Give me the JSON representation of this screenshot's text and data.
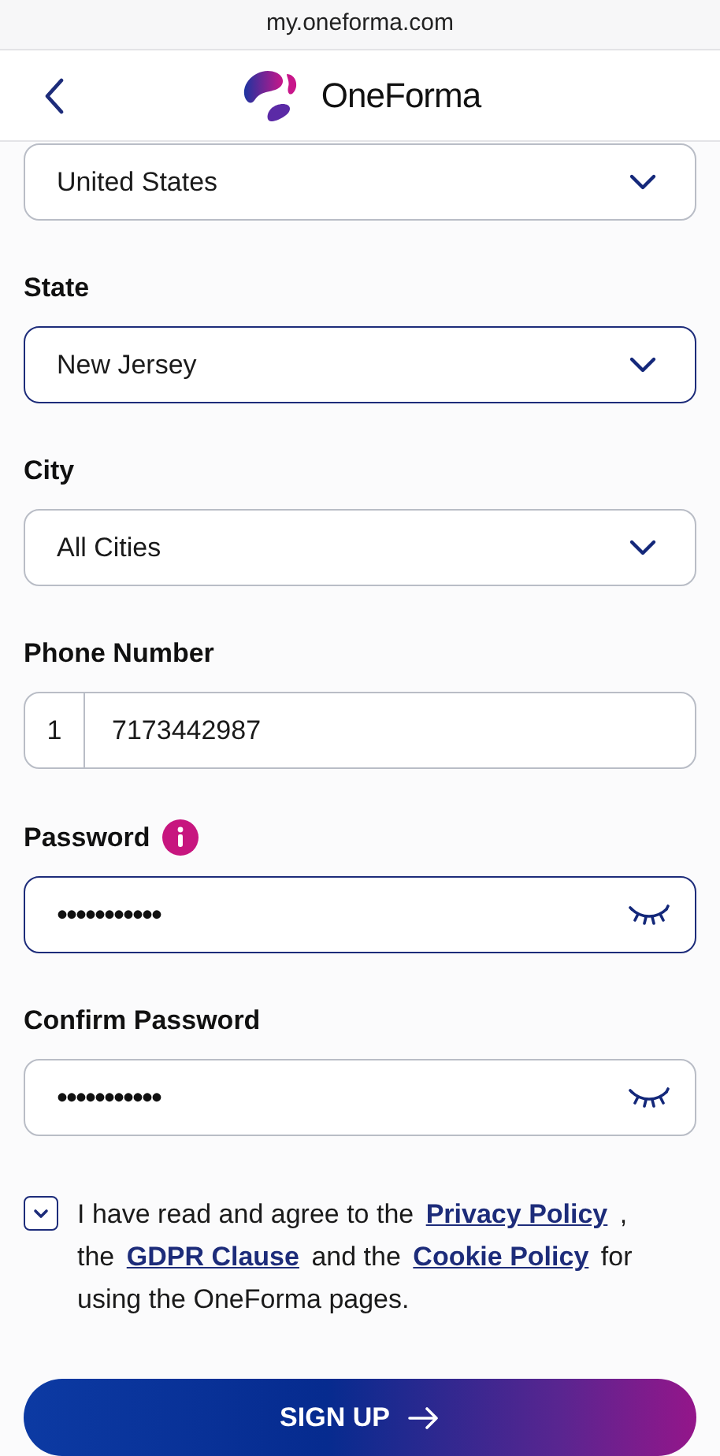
{
  "browser": {
    "url": "my.oneforma.com"
  },
  "header": {
    "brand": "OneForma"
  },
  "fields": [
    {
      "kind": "select",
      "value": "United States",
      "highlighted": false
    },
    {
      "kind": "select",
      "label": "State",
      "value": "New Jersey",
      "highlighted": true
    },
    {
      "kind": "select",
      "label": "City",
      "value": "All Cities",
      "highlighted": false
    },
    {
      "kind": "phone",
      "label": "Phone Number",
      "prefix": "1",
      "value": "7173442987",
      "highlighted": false
    },
    {
      "kind": "password",
      "label": "Password",
      "info": true,
      "value": "•••••••••••",
      "highlighted": true
    },
    {
      "kind": "password",
      "label": "Confirm Password",
      "info": false,
      "value": "•••••••••••",
      "highlighted": false
    }
  ],
  "agreement": {
    "checked": true,
    "parts": [
      {
        "kind": "text",
        "text": "I have read and agree to the"
      },
      {
        "kind": "link",
        "text": "Privacy Policy"
      },
      {
        "kind": "text",
        "text": ", the"
      },
      {
        "kind": "link",
        "text": "GDPR Clause"
      },
      {
        "kind": "text",
        "text": "and the"
      },
      {
        "kind": "link",
        "text": "Cookie Policy"
      },
      {
        "kind": "text",
        "text": "for using the OneForma pages."
      }
    ]
  },
  "submit": {
    "label": "SIGN UP"
  }
}
